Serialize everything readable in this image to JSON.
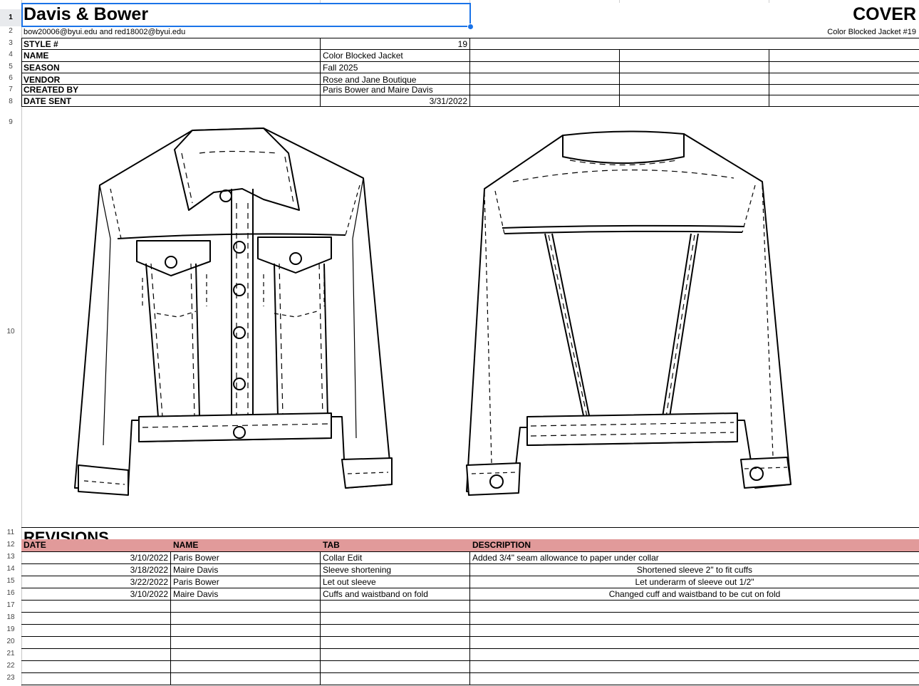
{
  "header": {
    "company": "Davis & Bower",
    "emails": "bow20006@byui.edu and red18002@byui.edu",
    "cover_label": "COVER",
    "cover_sub": "Color Blocked Jacket #19"
  },
  "spec": [
    {
      "label": "STYLE #",
      "value": "19"
    },
    {
      "label": "NAME",
      "value": "Color Blocked Jacket"
    },
    {
      "label": "SEASON",
      "value": "Fall 2025"
    },
    {
      "label": "VENDOR",
      "value": "Rose and Jane Boutique"
    },
    {
      "label": "CREATED BY",
      "value": "Paris Bower and Maire Davis"
    },
    {
      "label": "DATE SENT",
      "value": "3/31/2022"
    }
  ],
  "row_numbers": [
    "1",
    "2",
    "3",
    "4",
    "5",
    "6",
    "7",
    "8",
    "9",
    "10",
    "11",
    "12",
    "13",
    "14",
    "15",
    "16",
    "17",
    "18",
    "19",
    "20",
    "21",
    "22",
    "23"
  ],
  "revisions": {
    "title": "REVISIONS",
    "headers": {
      "date": "DATE",
      "name": "NAME",
      "tab": "TAB",
      "description": "DESCRIPTION"
    },
    "rows": [
      {
        "date": "3/10/2022",
        "name": "Paris Bower",
        "tab": "Collar Edit",
        "description": "Added 3/4\" seam allowance to paper under collar"
      },
      {
        "date": "3/18/2022",
        "name": "Maire Davis",
        "tab": "Sleeve shortening",
        "description": "Shortened sleeve 2\" to fit cuffs"
      },
      {
        "date": "3/22/2022",
        "name": "Paris Bower",
        "tab": "Let out sleeve",
        "description": "Let underarm of sleeve out 1/2\""
      },
      {
        "date": "3/10/2022",
        "name": "Maire Davis",
        "tab": "Cuffs and waistband on fold",
        "description": "Changed cuff and waistband to be cut on fold"
      }
    ]
  },
  "sketch": {
    "front": "jacket-front-icon",
    "back": "jacket-back-icon"
  }
}
